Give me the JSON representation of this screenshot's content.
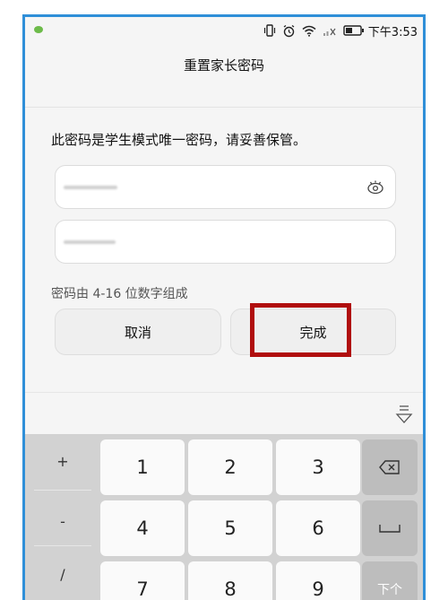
{
  "status_bar": {
    "time": "下午3:53",
    "icons": [
      "vibrate-icon",
      "alarm-icon",
      "wifi-icon",
      "signal-icon",
      "battery-icon"
    ]
  },
  "title": "重置家长密码",
  "hint_top": "此密码是学生模式唯一密码，请妥善保管。",
  "hint_rule": "密码由 4-16 位数字组成",
  "buttons": {
    "cancel": "取消",
    "done": "完成"
  },
  "keyboard": {
    "symbols": [
      "+",
      "-",
      "/"
    ],
    "digits": [
      "1",
      "2",
      "3",
      "4",
      "5",
      "6",
      "7",
      "8",
      "9"
    ],
    "next": "下个"
  },
  "colors": {
    "highlight": "#b00e0e",
    "frame": "#2f8fd8"
  }
}
